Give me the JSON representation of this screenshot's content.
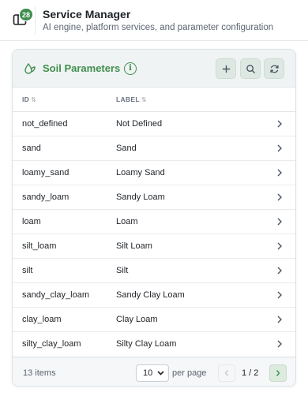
{
  "header": {
    "title": "Service Manager",
    "subtitle": "AI engine, platform services, and parameter configuration",
    "badge_count": "28",
    "icon": "panel-layout-icon"
  },
  "card": {
    "title": "Soil Parameters",
    "title_icon": "leaf-drop-icon",
    "info_icon": "info-icon",
    "actions": [
      "add-icon",
      "search-icon",
      "refresh-icon"
    ],
    "accent_color": "#3f8f4f"
  },
  "table": {
    "columns": [
      "ID",
      "LABEL"
    ],
    "rows": [
      {
        "id": "not_defined",
        "label": "Not Defined"
      },
      {
        "id": "sand",
        "label": "Sand"
      },
      {
        "id": "loamy_sand",
        "label": "Loamy Sand"
      },
      {
        "id": "sandy_loam",
        "label": "Sandy Loam"
      },
      {
        "id": "loam",
        "label": "Loam"
      },
      {
        "id": "silt_loam",
        "label": "Silt Loam"
      },
      {
        "id": "silt",
        "label": "Silt"
      },
      {
        "id": "sandy_clay_loam",
        "label": "Sandy Clay Loam"
      },
      {
        "id": "clay_loam",
        "label": "Clay Loam"
      },
      {
        "id": "silty_clay_loam",
        "label": "Silty Clay Loam"
      }
    ]
  },
  "footer": {
    "count": "13 items",
    "page_size": "10",
    "per_page_label": "per page",
    "page_indicator": "1 / 2"
  }
}
